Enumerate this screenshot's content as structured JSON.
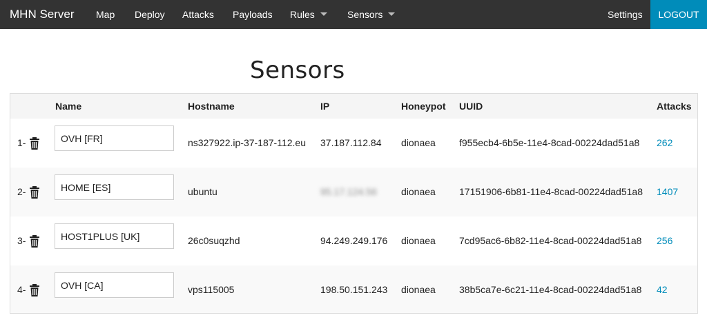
{
  "nav": {
    "brand": "MHN Server",
    "items": [
      "Map",
      "Deploy",
      "Attacks",
      "Payloads",
      "Rules",
      "Sensors"
    ],
    "settings": "Settings",
    "logout": "LOGOUT",
    "logout_color": "#008cba",
    "bar_color": "#333333"
  },
  "page": {
    "title": "Sensors"
  },
  "table": {
    "headers": {
      "name": "Name",
      "hostname": "Hostname",
      "ip": "IP",
      "honeypot": "Honeypot",
      "uuid": "UUID",
      "attacks": "Attacks"
    },
    "rows": [
      {
        "index": "1-",
        "name": "OVH [FR]",
        "hostname": "ns327922.ip-37-187-112.eu",
        "ip": "37.187.112.84",
        "honeypot": "dionaea",
        "uuid": "f955ecb4-6b5e-11e4-8cad-00224dad51a8",
        "attacks": "262"
      },
      {
        "index": "2-",
        "name": "HOME [ES]",
        "hostname": "ubuntu",
        "ip": "95.17.124.56",
        "honeypot": "dionaea",
        "uuid": "17151906-6b81-11e4-8cad-00224dad51a8",
        "attacks": "1407"
      },
      {
        "index": "3-",
        "name": "HOST1PLUS [UK]",
        "hostname": "26c0suqzhd",
        "ip": "94.249.249.176",
        "honeypot": "dionaea",
        "uuid": "7cd95ac6-6b82-11e4-8cad-00224dad51a8",
        "attacks": "256"
      },
      {
        "index": "4-",
        "name": "OVH [CA]",
        "hostname": "vps115005",
        "ip": "198.50.151.243",
        "honeypot": "dionaea",
        "uuid": "38b5ca7e-6c21-11e4-8cad-00224dad51a8",
        "attacks": "42"
      }
    ]
  }
}
